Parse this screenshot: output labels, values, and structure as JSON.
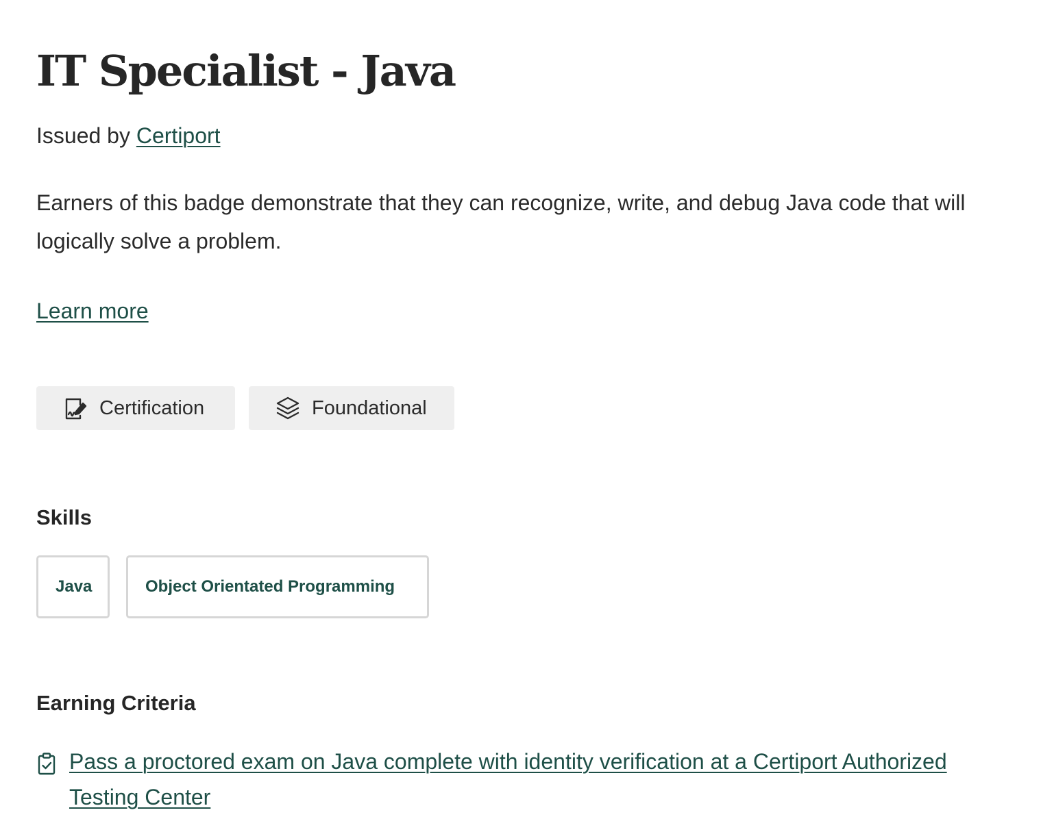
{
  "badge": {
    "title": "IT Specialist - Java",
    "issued_prefix": "Issued by",
    "issuer": "Certiport",
    "description": "Earners of this badge demonstrate that they can recognize, write, and debug Java code that will logically solve a problem.",
    "learn_more": "Learn more"
  },
  "tags": [
    {
      "label": "Certification",
      "icon": "certificate-icon"
    },
    {
      "label": "Foundational",
      "icon": "layers-icon"
    }
  ],
  "skills": {
    "heading": "Skills",
    "items": [
      "Java",
      "Object Orientated Programming"
    ]
  },
  "criteria": {
    "heading": "Earning Criteria",
    "items": [
      {
        "text": "Pass a proctored exam on Java complete with identity verification at a Certiport Authorized Testing Center",
        "icon": "clipboard-check-icon"
      }
    ]
  },
  "colors": {
    "link": "#1e4f47",
    "text": "#2b2b2b",
    "tag_bg": "#efefef",
    "skill_border": "#d6d6d6"
  }
}
